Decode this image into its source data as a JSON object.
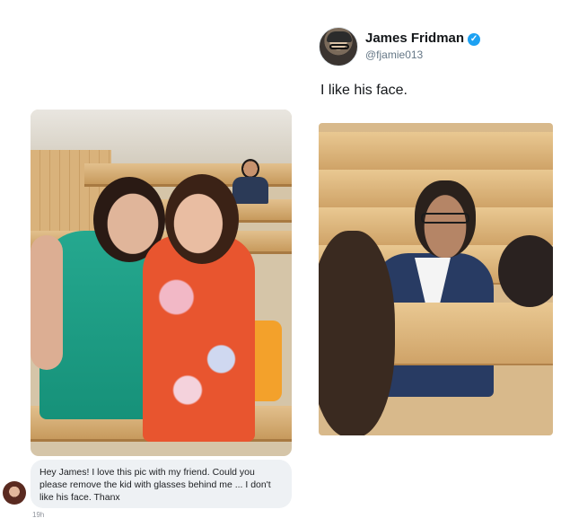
{
  "tweet": {
    "name": "James Fridman",
    "handle": "@fjamie013",
    "text": "I like his face."
  },
  "comment": {
    "text": "Hey James! I love this pic with my friend. Could you please remove the kid with glasses behind me  ... I don't like his face. Thanx",
    "time": "19h"
  },
  "icons": {
    "verified": "verified-badge-icon"
  },
  "colors": {
    "verified": "#1da1f2",
    "handle": "#657786",
    "bubble": "#eef1f4"
  }
}
